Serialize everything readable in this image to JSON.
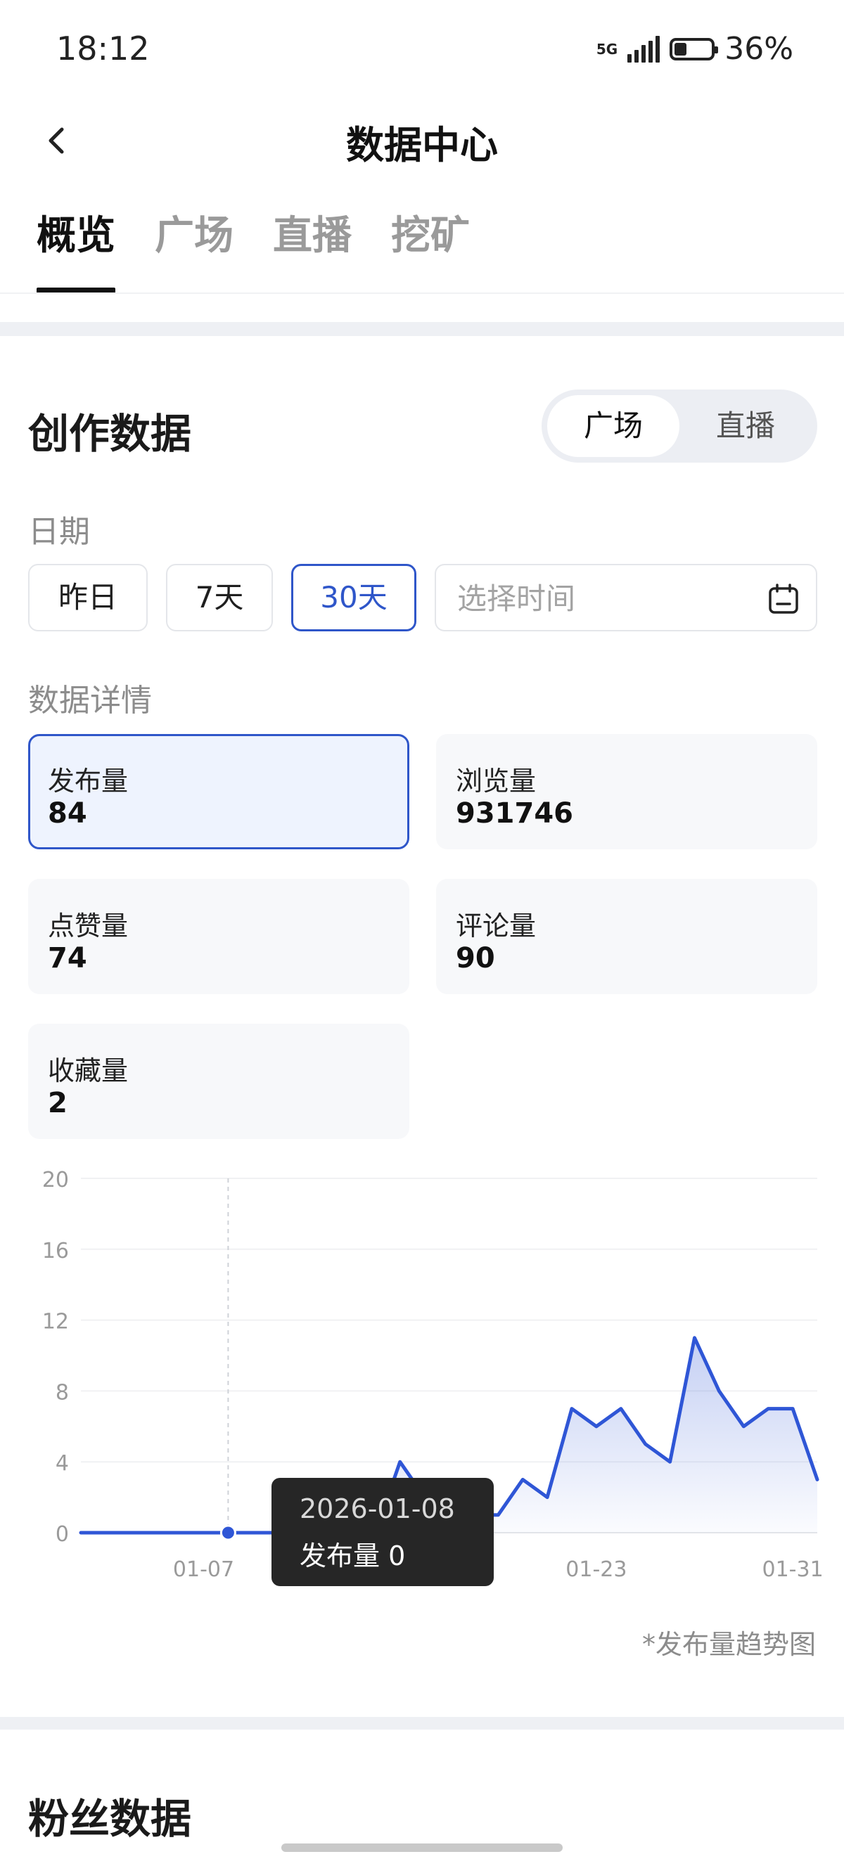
{
  "status_bar": {
    "time": "18:12",
    "network": "5G",
    "battery_percent": "36%",
    "battery_level": 0.36
  },
  "header": {
    "title": "数据中心"
  },
  "tabs": [
    {
      "label": "概览",
      "active": true
    },
    {
      "label": "广场",
      "active": false
    },
    {
      "label": "直播",
      "active": false
    },
    {
      "label": "挖矿",
      "active": false
    }
  ],
  "creation": {
    "title": "创作数据",
    "segment": {
      "options": [
        "广场",
        "直播"
      ],
      "selected": "广场"
    },
    "date_label": "日期",
    "date_chips": [
      "昨日",
      "7天",
      "30天"
    ],
    "selected_chip": "30天",
    "date_picker_placeholder": "选择时间",
    "details_label": "数据详情",
    "metrics": [
      {
        "label": "发布量",
        "value": "84",
        "selected": true
      },
      {
        "label": "浏览量",
        "value": "931746",
        "selected": false
      },
      {
        "label": "点赞量",
        "value": "74",
        "selected": false
      },
      {
        "label": "评论量",
        "value": "90",
        "selected": false
      },
      {
        "label": "收藏量",
        "value": "2",
        "selected": false
      }
    ]
  },
  "chart_data": {
    "type": "area",
    "y_ticks": [
      "20",
      "16",
      "12",
      "8",
      "4",
      "0"
    ],
    "ylim": [
      0,
      20
    ],
    "x_tick_labels": [
      "01-07",
      "01-15",
      "01-23",
      "01-31"
    ],
    "x": [
      "01-02",
      "01-03",
      "01-04",
      "01-05",
      "01-06",
      "01-07",
      "01-08",
      "01-09",
      "01-10",
      "01-11",
      "01-12",
      "01-13",
      "01-14",
      "01-15",
      "01-16",
      "01-17",
      "01-18",
      "01-19",
      "01-20",
      "01-21",
      "01-22",
      "01-23",
      "01-24",
      "01-25",
      "01-26",
      "01-27",
      "01-28",
      "01-29",
      "01-30",
      "01-31",
      "02-01"
    ],
    "series": [
      {
        "values": [
          0,
          0,
          0,
          0,
          0,
          0,
          0,
          0,
          0,
          0,
          0,
          0,
          0,
          4,
          2,
          1,
          1,
          1,
          3,
          2,
          7,
          6,
          7,
          5,
          4,
          11,
          8,
          6,
          7,
          7,
          3
        ]
      }
    ],
    "color": "#2f56d6",
    "grid": true,
    "highlight": {
      "x": "01-08",
      "value": 0
    },
    "caption": "*发布量趋势图"
  },
  "tooltip": {
    "date": "2026-01-08",
    "label": "发布量",
    "value": "0",
    "text": "发布量 0"
  },
  "fans": {
    "title": "粉丝数据"
  }
}
